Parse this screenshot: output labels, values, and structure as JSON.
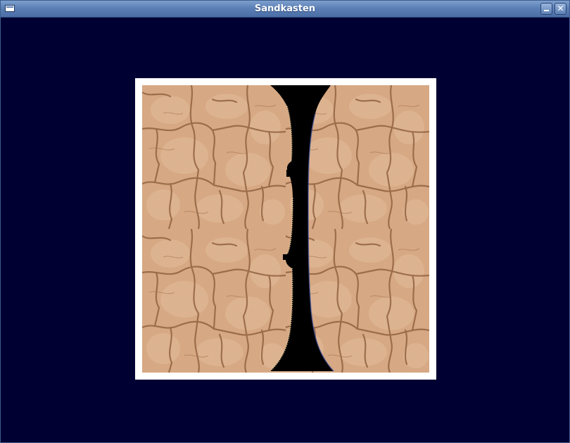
{
  "window": {
    "title": "Sandkasten"
  },
  "icons": {
    "menu": "window-menu-icon",
    "minimize": "minimize-icon",
    "close": "close-icon"
  },
  "colors": {
    "background": "#000033",
    "frame": "#ffffff",
    "sand": "#d8a880",
    "crack": "#8a5a3a",
    "cut": "#000000"
  }
}
